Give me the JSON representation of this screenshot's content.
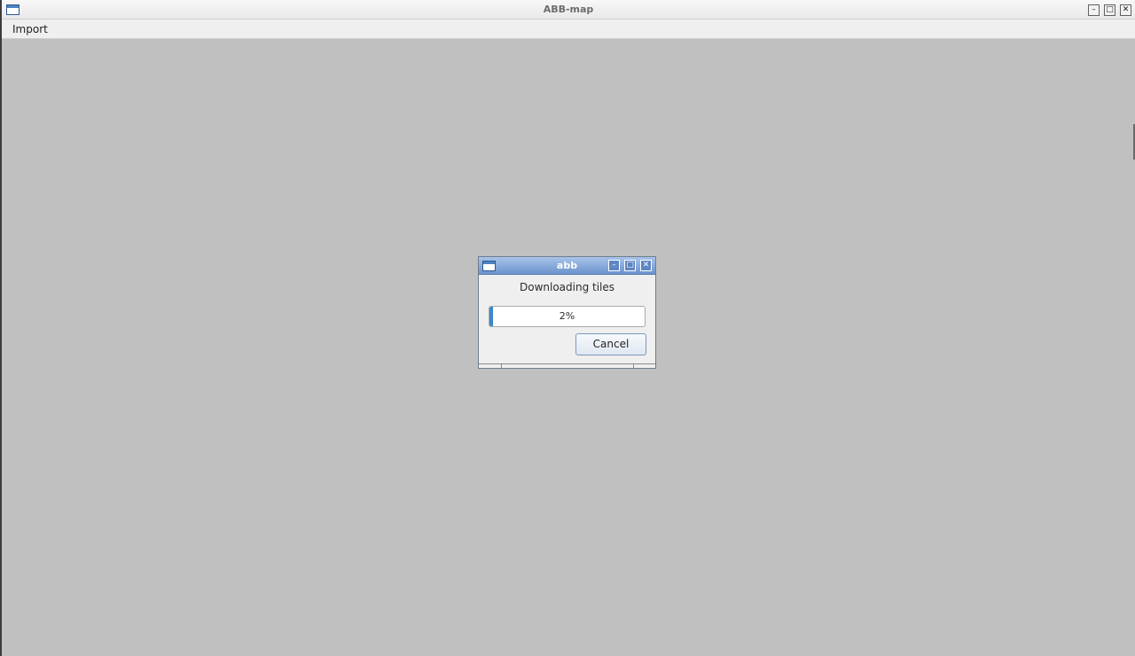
{
  "window": {
    "title": "ABB-map",
    "minimize_glyph": "–",
    "maximize_glyph": "□",
    "close_glyph": "✕"
  },
  "menubar": {
    "items": [
      {
        "label": "Import"
      }
    ]
  },
  "dialog": {
    "title": "abb",
    "message": "Downloading tiles",
    "progress": {
      "percent": 2,
      "text": "2%"
    },
    "cancel_label": "Cancel",
    "minimize_glyph": "–",
    "maximize_glyph": "□",
    "close_glyph": "✕"
  },
  "colors": {
    "desktop_background": "#c0c0c0",
    "dialog_titlebar": "#6b93cd",
    "progress_fill": "#3f87c9"
  },
  "icons": {
    "app_icon": "window-icon",
    "dialog_icon": "window-icon"
  }
}
